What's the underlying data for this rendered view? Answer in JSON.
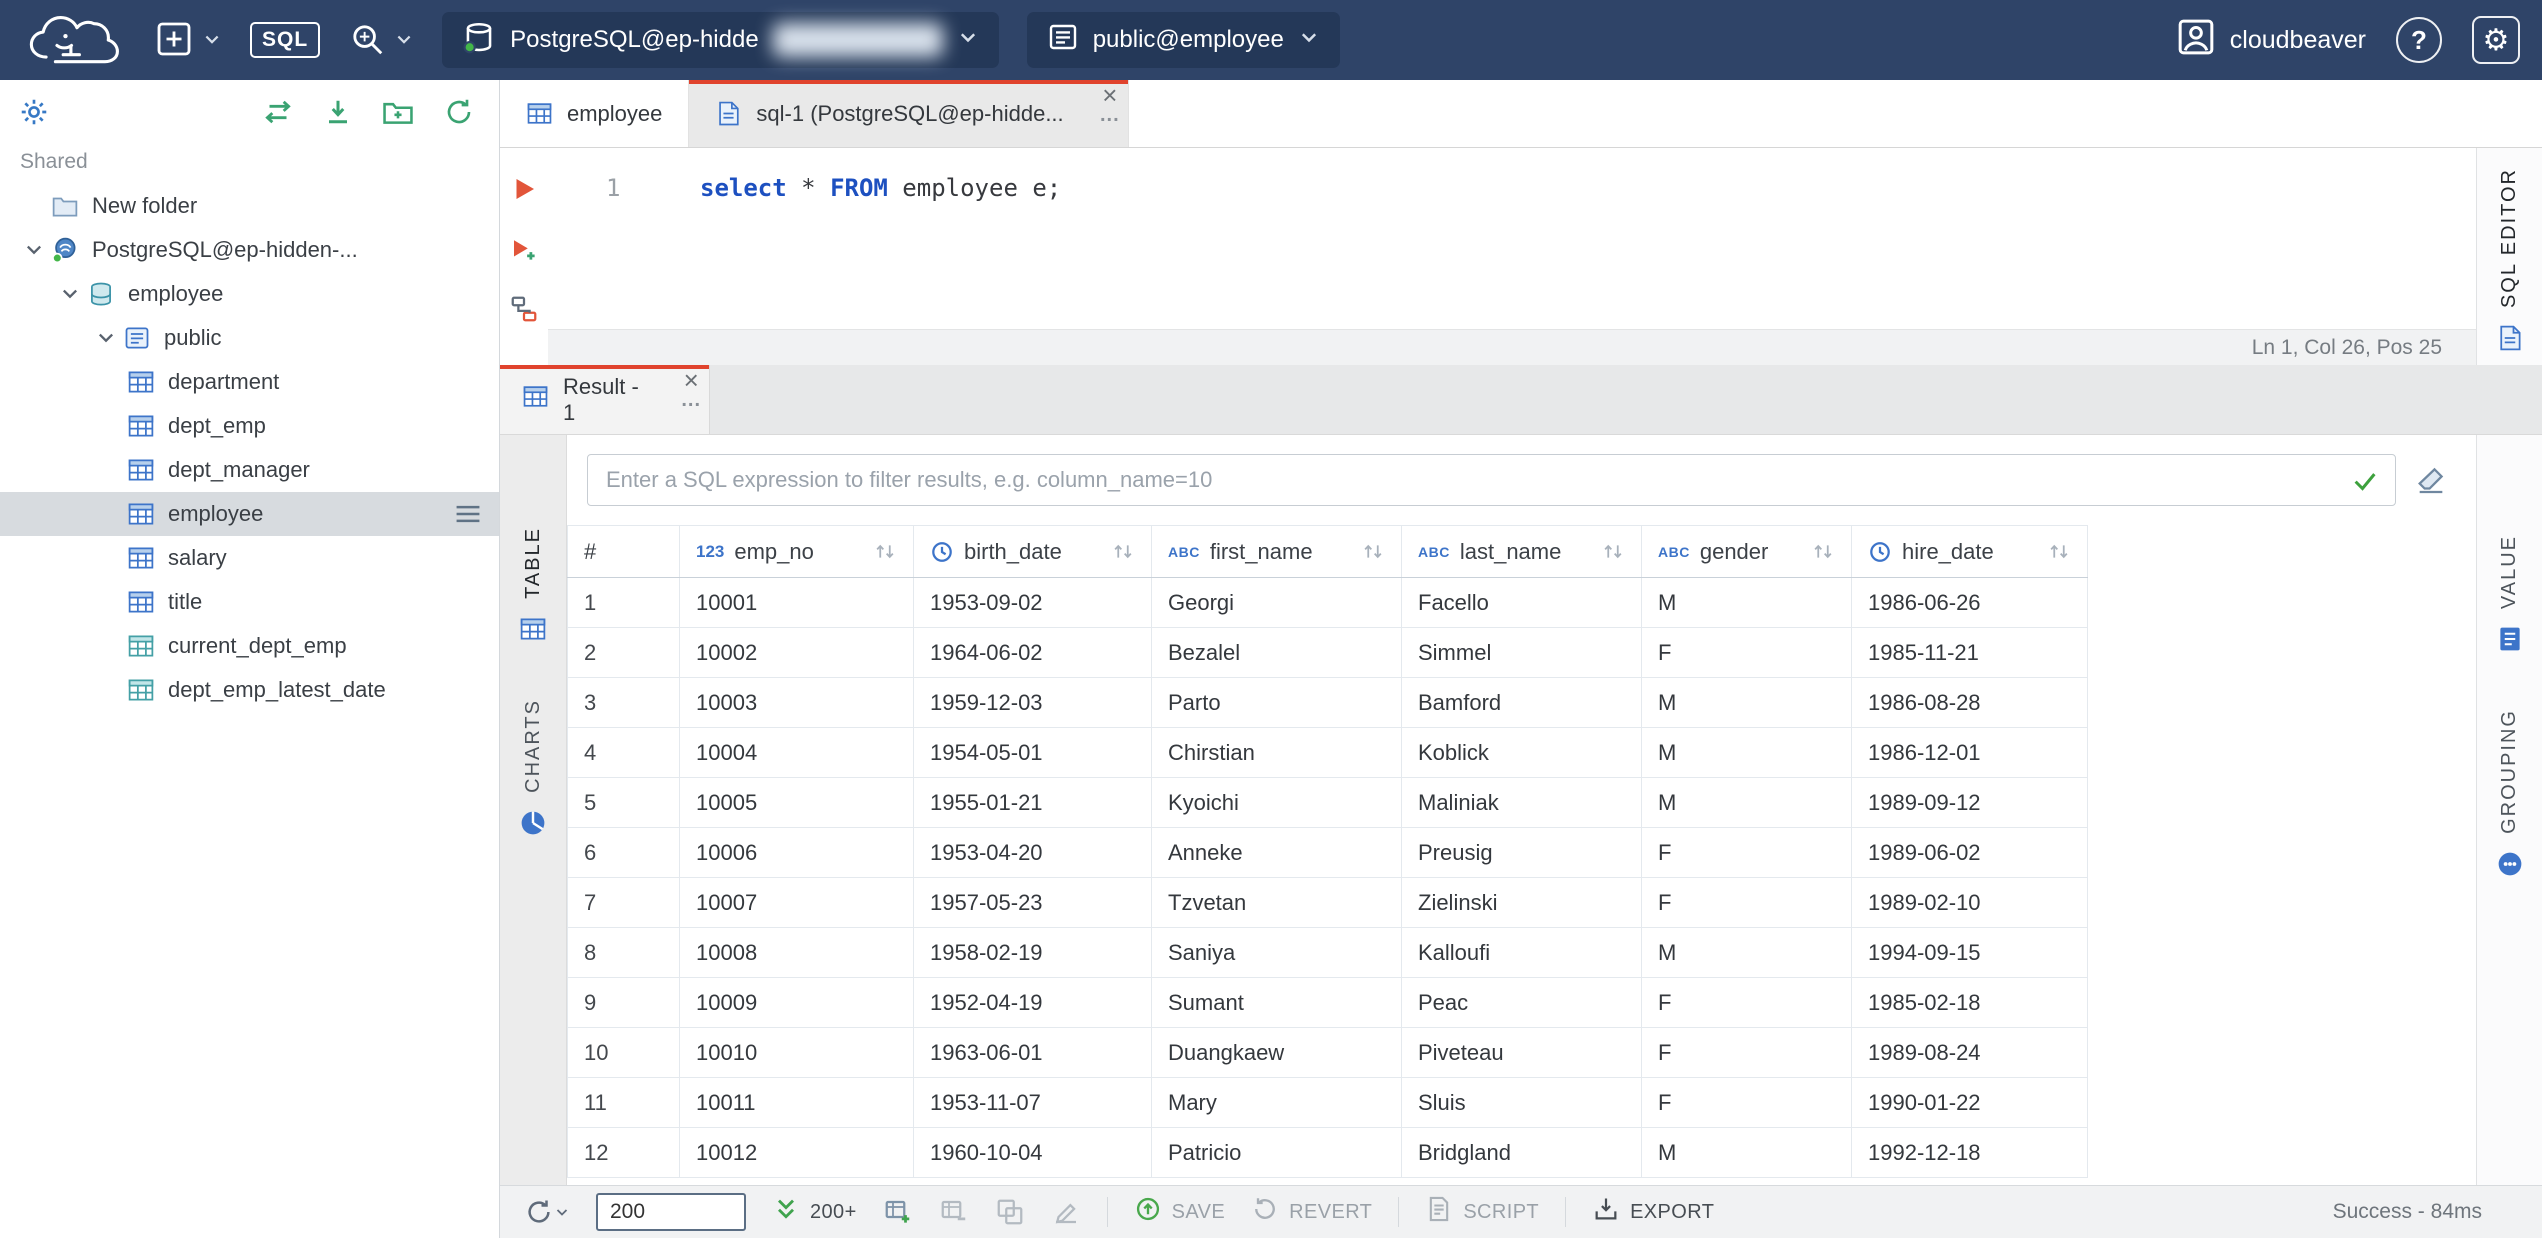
{
  "topbar": {
    "sql_badge": "SQL",
    "connection": {
      "label": "PostgreSQL@ep-hidde"
    },
    "schema": {
      "label": "public@employee"
    },
    "user": {
      "name": "cloudbeaver"
    },
    "help": "?"
  },
  "glyphs": {
    "close": "×",
    "more": "..."
  },
  "sidebar": {
    "section_label": "Shared",
    "tree": [
      {
        "label": "New folder",
        "level": 0,
        "icon": "folder-icon",
        "chevron": false,
        "placeholder": true
      },
      {
        "label": "PostgreSQL@ep-hidden-...",
        "level": 0,
        "icon": "connection-icon",
        "chevron": true
      },
      {
        "label": "employee",
        "level": 1,
        "icon": "database-icon",
        "chevron": true
      },
      {
        "label": "public",
        "level": 2,
        "icon": "schema-icon",
        "chevron": true
      },
      {
        "label": "department",
        "level": 3,
        "icon": "table-icon"
      },
      {
        "label": "dept_emp",
        "level": 3,
        "icon": "table-icon"
      },
      {
        "label": "dept_manager",
        "level": 3,
        "icon": "table-icon"
      },
      {
        "label": "employee",
        "level": 3,
        "icon": "table-icon",
        "selected": true
      },
      {
        "label": "salary",
        "level": 3,
        "icon": "table-icon"
      },
      {
        "label": "title",
        "level": 3,
        "icon": "table-icon"
      },
      {
        "label": "current_dept_emp",
        "level": 3,
        "icon": "view-icon"
      },
      {
        "label": "dept_emp_latest_date",
        "level": 3,
        "icon": "view-icon"
      }
    ]
  },
  "editor": {
    "tabs": [
      {
        "label": "employee"
      },
      {
        "label": "sql-1 (PostgreSQL@ep-hidde..."
      }
    ],
    "line_number": "1",
    "code": [
      {
        "text": "select"
      },
      {
        "text": " * "
      },
      {
        "text": "FROM"
      },
      {
        "text": " employee e;"
      }
    ],
    "status": "Ln 1, Col 26, Pos 25",
    "side_label": "SQL EDITOR"
  },
  "results": {
    "tab_label": "Result - 1",
    "filter_placeholder": "Enter a SQL expression to filter results, e.g. column_name=10",
    "left_tabs": [
      {
        "label": "TABLE"
      },
      {
        "label": "CHARTS"
      }
    ],
    "right_tabs": [
      {
        "label": "VALUE"
      },
      {
        "label": "GROUPING"
      }
    ],
    "grid": {
      "columns": [
        {
          "name": "#",
          "type": null
        },
        {
          "name": "emp_no",
          "type": "number"
        },
        {
          "name": "birth_date",
          "type": "date"
        },
        {
          "name": "first_name",
          "type": "text"
        },
        {
          "name": "last_name",
          "type": "text"
        },
        {
          "name": "gender",
          "type": "text"
        },
        {
          "name": "hire_date",
          "type": "date"
        }
      ],
      "rows": [
        [
          "1",
          "10001",
          "1953-09-02",
          "Georgi",
          "Facello",
          "M",
          "1986-06-26"
        ],
        [
          "2",
          "10002",
          "1964-06-02",
          "Bezalel",
          "Simmel",
          "F",
          "1985-11-21"
        ],
        [
          "3",
          "10003",
          "1959-12-03",
          "Parto",
          "Bamford",
          "M",
          "1986-08-28"
        ],
        [
          "4",
          "10004",
          "1954-05-01",
          "Chirstian",
          "Koblick",
          "M",
          "1986-12-01"
        ],
        [
          "5",
          "10005",
          "1955-01-21",
          "Kyoichi",
          "Maliniak",
          "M",
          "1989-09-12"
        ],
        [
          "6",
          "10006",
          "1953-04-20",
          "Anneke",
          "Preusig",
          "F",
          "1989-06-02"
        ],
        [
          "7",
          "10007",
          "1957-05-23",
          "Tzvetan",
          "Zielinski",
          "F",
          "1989-02-10"
        ],
        [
          "8",
          "10008",
          "1958-02-19",
          "Saniya",
          "Kalloufi",
          "M",
          "1994-09-15"
        ],
        [
          "9",
          "10009",
          "1952-04-19",
          "Sumant",
          "Peac",
          "F",
          "1985-02-18"
        ],
        [
          "10",
          "10010",
          "1963-06-01",
          "Duangkaew",
          "Piveteau",
          "F",
          "1989-08-24"
        ],
        [
          "11",
          "10011",
          "1953-11-07",
          "Mary",
          "Sluis",
          "F",
          "1990-01-22"
        ],
        [
          "12",
          "10012",
          "1960-10-04",
          "Patricio",
          "Bridgland",
          "M",
          "1992-12-18"
        ]
      ]
    }
  },
  "statusbar": {
    "fetch_size": "200",
    "fetch_more_label": "200+",
    "save_label": "SAVE",
    "revert_label": "REVERT",
    "script_label": "SCRIPT",
    "export_label": "EXPORT",
    "status": "Success - 84ms"
  }
}
